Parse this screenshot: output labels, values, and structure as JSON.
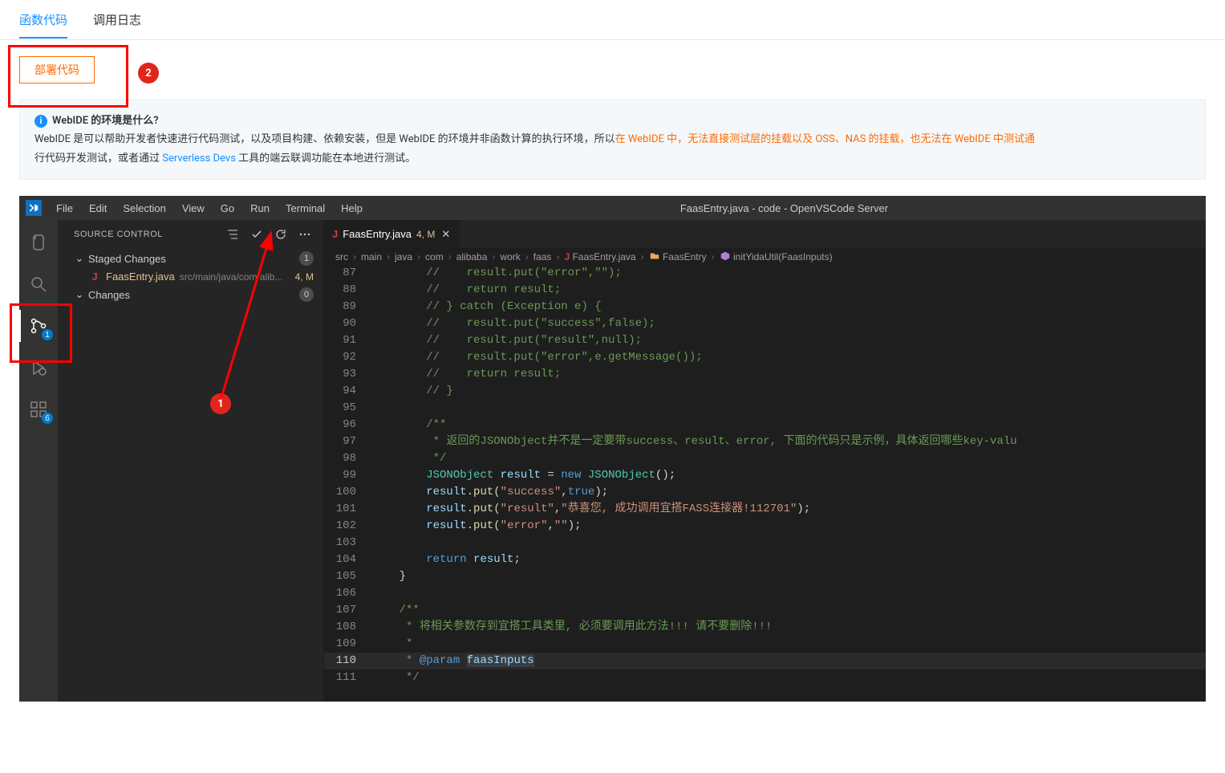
{
  "tabs": {
    "code": "函数代码",
    "logs": "调用日志"
  },
  "deploy_btn": "部署代码",
  "annotations": {
    "circle1": "1",
    "circle2": "2"
  },
  "info": {
    "title": "WebIDE 的环境是什么?",
    "pre": "WebIDE 是可以帮助开发者快速进行代码测试，以及项目构建、依赖安装，但是 WebIDE 的环境并非函数计算的执行环境，所以",
    "warn": "在 WebIDE 中，无法直接测试层的挂载以及 OSS、NAS 的挂载，也无法在 WebIDE 中测试通",
    "line2a": "行代码开发测试，或者通过 ",
    "link": "Serverless Devs",
    "line2b": " 工具的端云联调功能在本地进行测试。"
  },
  "ide": {
    "menu": [
      "File",
      "Edit",
      "Selection",
      "View",
      "Go",
      "Run",
      "Terminal",
      "Help"
    ],
    "title": "FaasEntry.java - code - OpenVSCode Server",
    "activity_badges": {
      "scm": "1",
      "ext": "6"
    },
    "source_control": {
      "header": "SOURCE CONTROL",
      "staged": {
        "label": "Staged Changes",
        "count": "1"
      },
      "changes": {
        "label": "Changes",
        "count": "0"
      },
      "file": {
        "icon": "J",
        "name": "FaasEntry.java",
        "path": "src/main/java/com/alib...",
        "stat": "4, M"
      }
    },
    "editor_tab": {
      "icon": "J",
      "label": "FaasEntry.java",
      "stat": "4, M"
    },
    "breadcrumbs": [
      "src",
      "main",
      "java",
      "com",
      "alibaba",
      "work",
      "faas",
      "FaasEntry.java",
      "FaasEntry",
      "initYidaUtil(FaasInputs)"
    ],
    "code": [
      {
        "n": 87,
        "t": "        //    result.put(\"error\",\"\");",
        "cls": "c-comment"
      },
      {
        "n": 88,
        "t": "        //    return result;",
        "cls": "c-comment"
      },
      {
        "n": 89,
        "t": "        // } catch (Exception e) {",
        "cls": "c-comment"
      },
      {
        "n": 90,
        "t": "        //    result.put(\"success\",false);",
        "cls": "c-comment"
      },
      {
        "n": 91,
        "t": "        //    result.put(\"result\",null);",
        "cls": "c-comment"
      },
      {
        "n": 92,
        "t": "        //    result.put(\"error\",e.getMessage());",
        "cls": "c-comment"
      },
      {
        "n": 93,
        "t": "        //    return result;",
        "cls": "c-comment"
      },
      {
        "n": 94,
        "t": "        // }",
        "cls": "c-comment"
      },
      {
        "n": 95,
        "t": "",
        "cls": ""
      },
      {
        "n": 96,
        "t": "        /**",
        "cls": "c-doc"
      },
      {
        "n": 97,
        "t": "         * 返回的JSONObject并不是一定要带success、result、error, 下面的代码只是示例，具体返回哪些key-valu",
        "cls": "c-doc"
      },
      {
        "n": 98,
        "t": "         */",
        "cls": "c-doc"
      },
      {
        "n": 99,
        "html": "        <span class='c-type'>JSONObject</span> <span class='c-var'>result</span> = <span class='c-kw'>new</span> <span class='c-type'>JSONObject</span>();"
      },
      {
        "n": 100,
        "html": "        <span class='c-var'>result</span>.<span class='c-fn'>put</span>(<span class='c-str'>\"success\"</span>,<span class='c-bool'>true</span>);"
      },
      {
        "n": 101,
        "html": "        <span class='c-var'>result</span>.<span class='c-fn'>put</span>(<span class='c-str'>\"result\"</span>,<span class='c-str'>\"恭喜您, 成功调用宜搭FASS连接器!112701\"</span>);"
      },
      {
        "n": 102,
        "html": "        <span class='c-var'>result</span>.<span class='c-fn'>put</span>(<span class='c-str'>\"error\"</span>,<span class='c-str'>\"\"</span>);"
      },
      {
        "n": 103,
        "t": "",
        "cls": ""
      },
      {
        "n": 104,
        "html": "        <span class='c-kw'>return</span> <span class='c-var'>result</span>;"
      },
      {
        "n": 105,
        "t": "    }",
        "cls": ""
      },
      {
        "n": 106,
        "t": "",
        "cls": ""
      },
      {
        "n": 107,
        "t": "    /**",
        "cls": "c-doc"
      },
      {
        "n": 108,
        "t": "     * 将相关参数存到宜搭工具类里, 必须要调用此方法!!! 请不要删除!!!",
        "cls": "c-doc"
      },
      {
        "n": 109,
        "t": "     *",
        "cls": "c-doc"
      },
      {
        "n": 110,
        "html": "     <span class='c-doc'>*</span> <span class='c-doctag'>@param</span> <span class='c-paramhl'>faasInputs</span>",
        "cur": true
      },
      {
        "n": 111,
        "t": "     */",
        "cls": "c-doc"
      }
    ]
  }
}
